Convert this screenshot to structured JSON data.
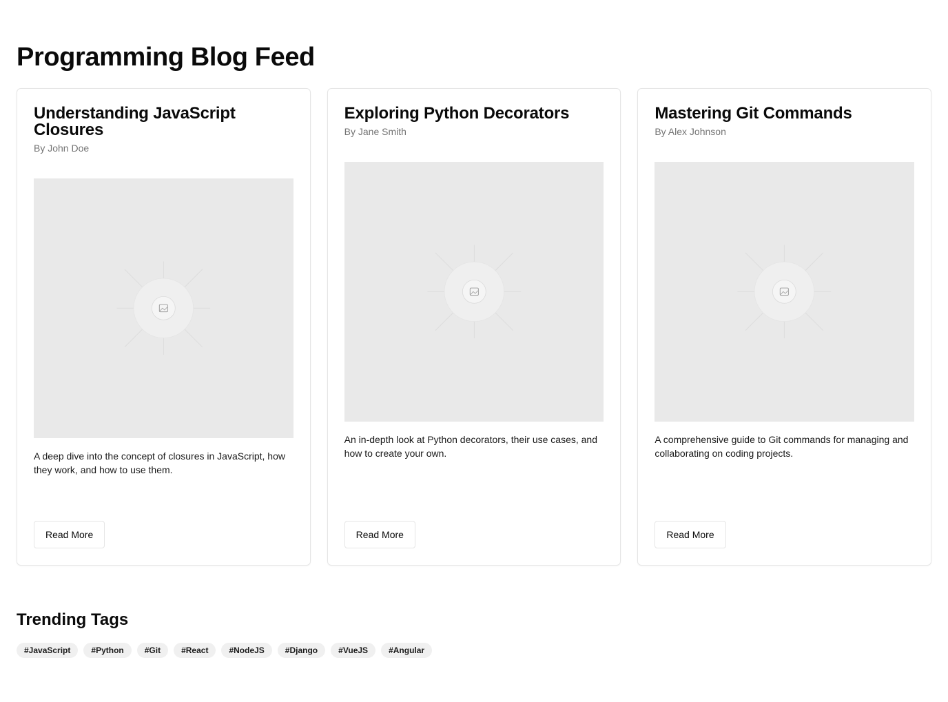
{
  "page": {
    "title": "Programming Blog Feed"
  },
  "posts": [
    {
      "title": "Understanding JavaScript Closures",
      "author": "By John Doe",
      "image_icon": "image-placeholder-icon",
      "description": "A deep dive into the concept of closures in JavaScript, how they work, and how to use them.",
      "button_label": "Read More"
    },
    {
      "title": "Exploring Python Decorators",
      "author": "By Jane Smith",
      "image_icon": "image-placeholder-icon",
      "description": "An in-depth look at Python decorators, their use cases, and how to create your own.",
      "button_label": "Read More"
    },
    {
      "title": "Mastering Git Commands",
      "author": "By Alex Johnson",
      "image_icon": "image-placeholder-icon",
      "description": "A comprehensive guide to Git commands for managing and collaborating on coding projects.",
      "button_label": "Read More"
    }
  ],
  "trending": {
    "title": "Trending Tags",
    "tags": [
      "#JavaScript",
      "#Python",
      "#Git",
      "#React",
      "#NodeJS",
      "#Django",
      "#VueJS",
      "#Angular"
    ]
  },
  "colors": {
    "text": "#0a0a0a",
    "muted": "#737373",
    "border": "#e5e5e5",
    "placeholder_bg": "#e9e9e9",
    "tag_bg": "#f0f0f0"
  }
}
